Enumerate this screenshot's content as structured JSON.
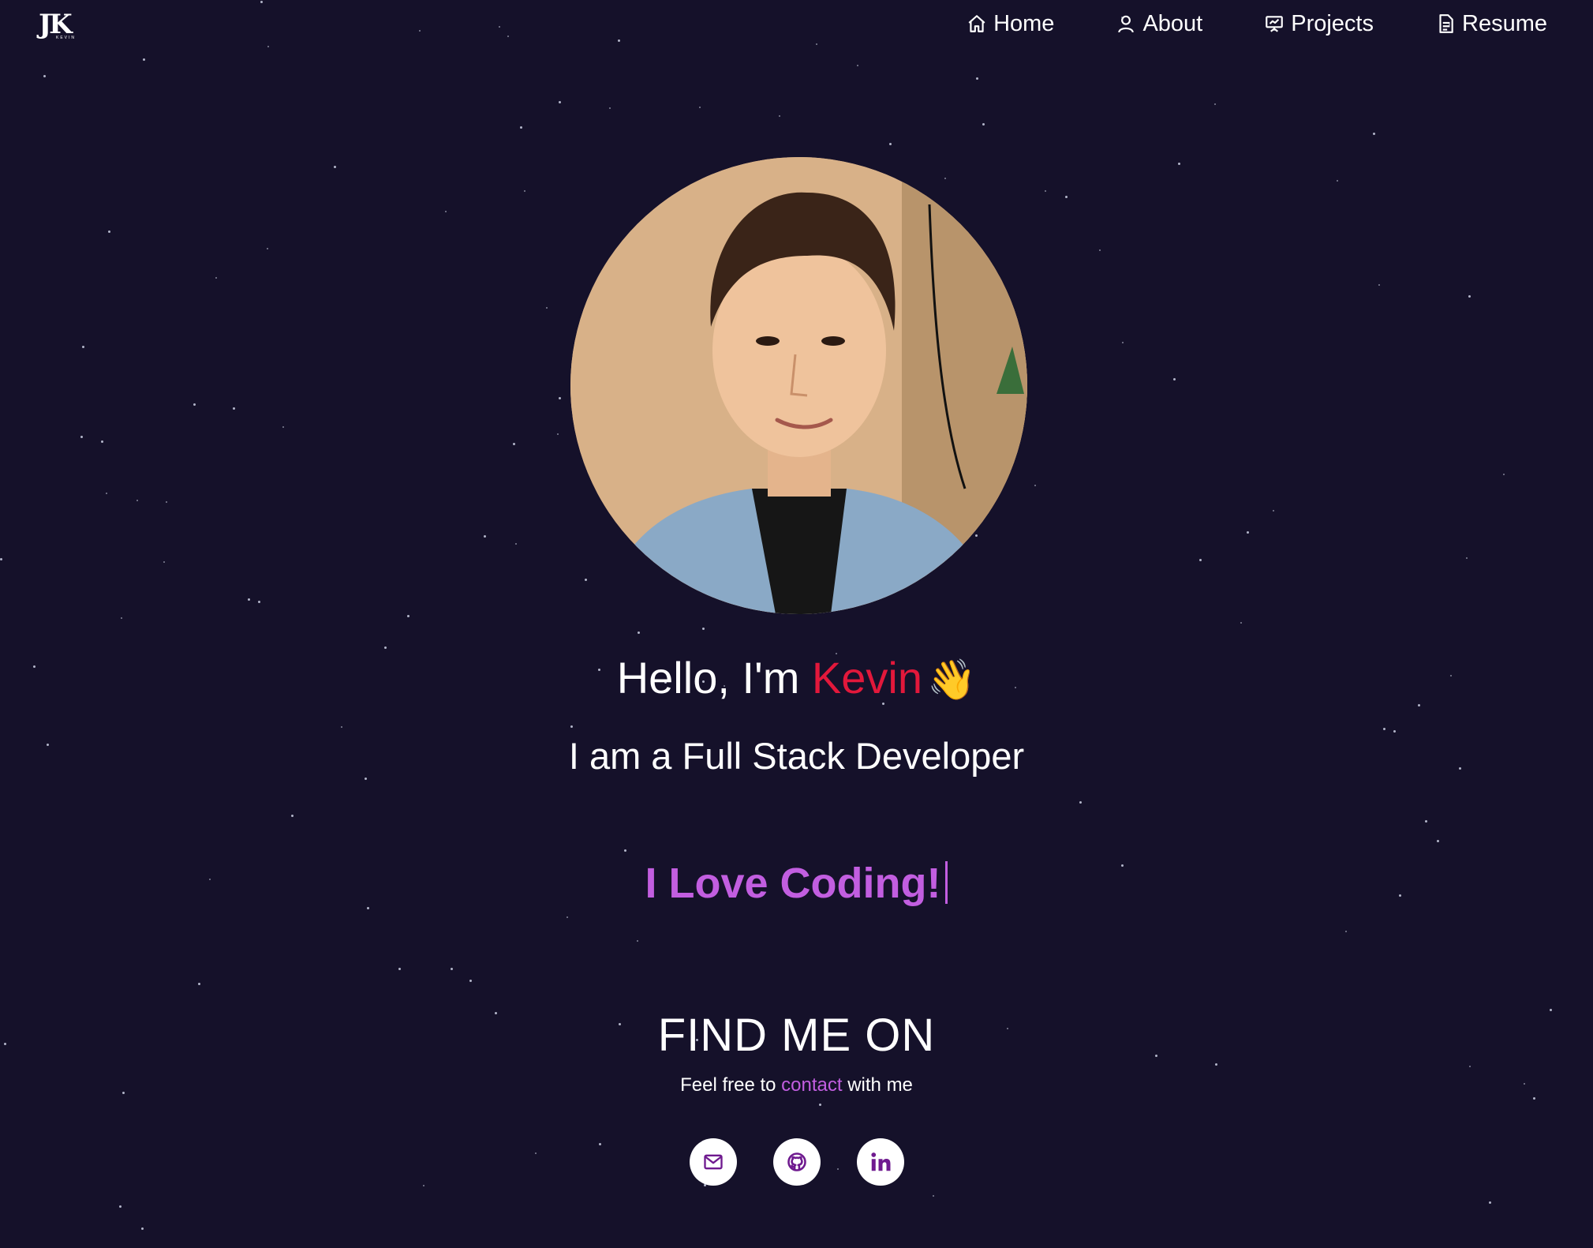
{
  "logo": {
    "text": "JK",
    "subtext": "KEVIN"
  },
  "nav": {
    "items": [
      {
        "label": "Home",
        "icon": "home-icon"
      },
      {
        "label": "About",
        "icon": "user-icon"
      },
      {
        "label": "Projects",
        "icon": "presentation-icon"
      },
      {
        "label": "Resume",
        "icon": "document-icon"
      }
    ]
  },
  "hero": {
    "hello_prefix": "Hello, I'm ",
    "name": "Kevin",
    "wave": "👋",
    "role": "I am a Full Stack Developer",
    "typing_text": "I Love Coding!"
  },
  "find": {
    "title": "FIND ME ON",
    "feel_prefix": "Feel free to ",
    "contact_link": "contact",
    "feel_suffix": " with me"
  },
  "socials": [
    {
      "name": "email",
      "icon": "mail-icon"
    },
    {
      "name": "github",
      "icon": "github-icon"
    },
    {
      "name": "linkedin",
      "icon": "linkedin-icon"
    }
  ],
  "colors": {
    "background": "#15112a",
    "accent_red": "#e2183b",
    "accent_purple": "#c25ee0"
  }
}
